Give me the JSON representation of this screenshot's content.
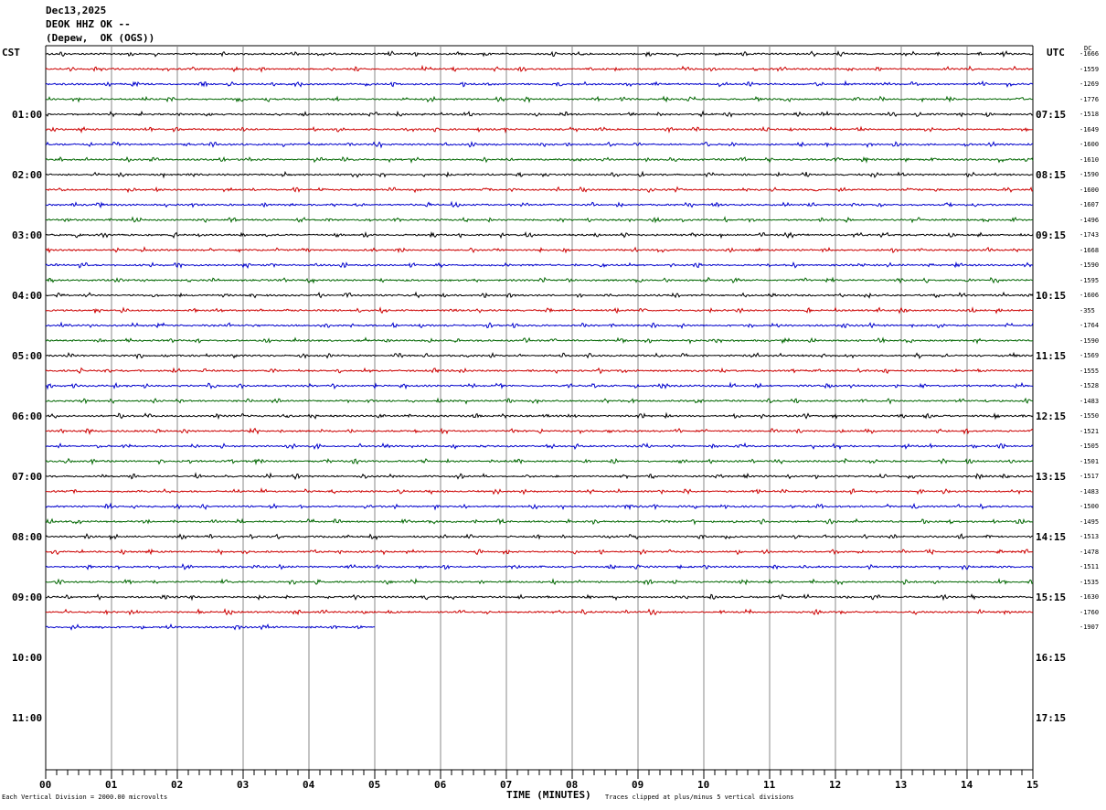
{
  "header": {
    "date": "Dec13,2025",
    "station": "DEOK HHZ OK --",
    "location": "(Depew,  OK (OGS))"
  },
  "left_axis_title": "CST",
  "right_axis_title": "UTC",
  "dc_title": "DC",
  "cst_labels": [
    "01:00",
    "02:00",
    "03:00",
    "04:00",
    "05:00",
    "06:00",
    "07:00",
    "08:00",
    "09:00",
    "10:00",
    "11:00"
  ],
  "utc_labels": [
    "07:15",
    "08:15",
    "09:15",
    "10:15",
    "11:15",
    "12:15",
    "13:15",
    "14:15",
    "15:15",
    "16:15",
    "17:15"
  ],
  "chart_data": {
    "type": "line",
    "xlabel": "TIME (MINUTES)",
    "x_ticks": [
      "00",
      "01",
      "02",
      "03",
      "04",
      "05",
      "06",
      "07",
      "08",
      "09",
      "10",
      "11",
      "12",
      "13",
      "14",
      "15"
    ],
    "xlim": [
      0,
      15
    ],
    "traces_per_hour": 4,
    "trace_colors": [
      "#000000",
      "#cc0000",
      "#0000cc",
      "#006600"
    ],
    "dc_offsets": [
      "-1666",
      "-1559",
      "-1269",
      "-1776",
      "-1518",
      "-1649",
      "-1600",
      "-1610",
      "-1590",
      "-1600",
      "-1607",
      "-1496",
      "-1743",
      "-1668",
      "-1590",
      "-1595",
      "-1606",
      "-355",
      "-1764",
      "-1590",
      "-1569",
      "-1555",
      "-1528",
      "-1483",
      "-1550",
      "-1521",
      "-1505",
      "-1501",
      "-1517",
      "-1483",
      "-1500",
      "-1495",
      "-1513",
      "-1478",
      "-1511",
      "-1535",
      "-1630",
      "-1760",
      "-1907"
    ],
    "trace_count": 39,
    "last_trace_end_minute": 5
  },
  "footer": {
    "left": "Each Vertical Division = 2000.00 microvolts",
    "right": "Traces clipped at plus/minus 5 vertical divisions"
  }
}
